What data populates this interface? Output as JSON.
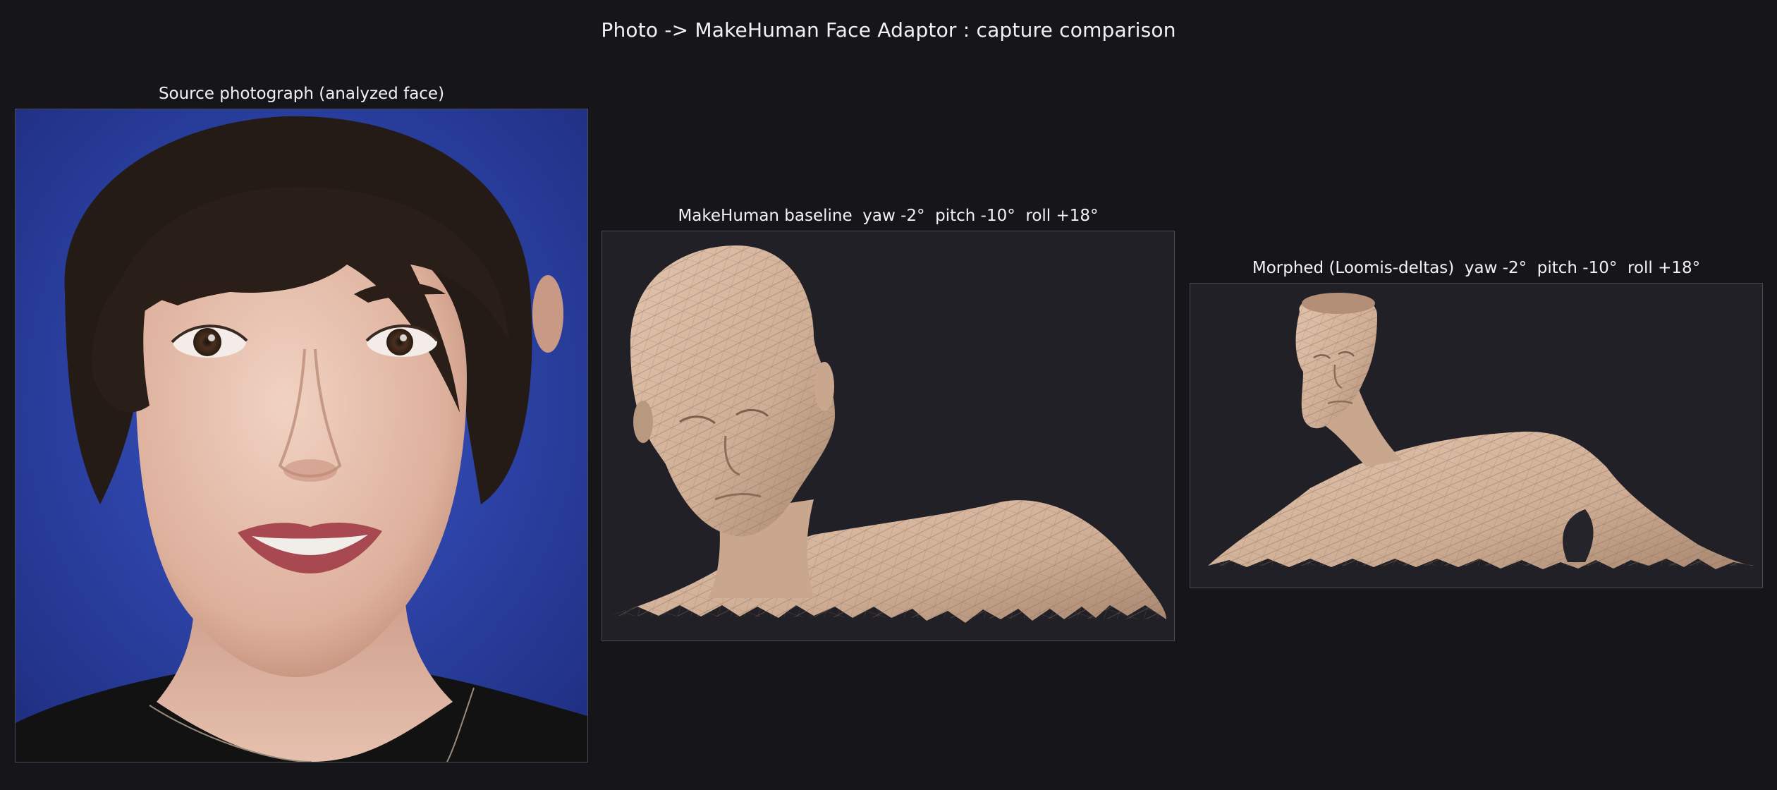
{
  "header": {
    "title": "Photo -> MakeHuman Face Adaptor : capture comparison"
  },
  "panels": {
    "source": {
      "title": "Source photograph (analyzed face)"
    },
    "baseline": {
      "title": "MakeHuman baseline  yaw -2°  pitch -10°  roll +18°"
    },
    "morphed": {
      "title": "Morphed (Loomis-deltas)  yaw -2°  pitch -10°  roll +18°"
    }
  },
  "colors": {
    "background": "#16161a",
    "render_background": "#202026",
    "skin": "#d8b8a0",
    "photo_background": "#2c3f9e"
  }
}
